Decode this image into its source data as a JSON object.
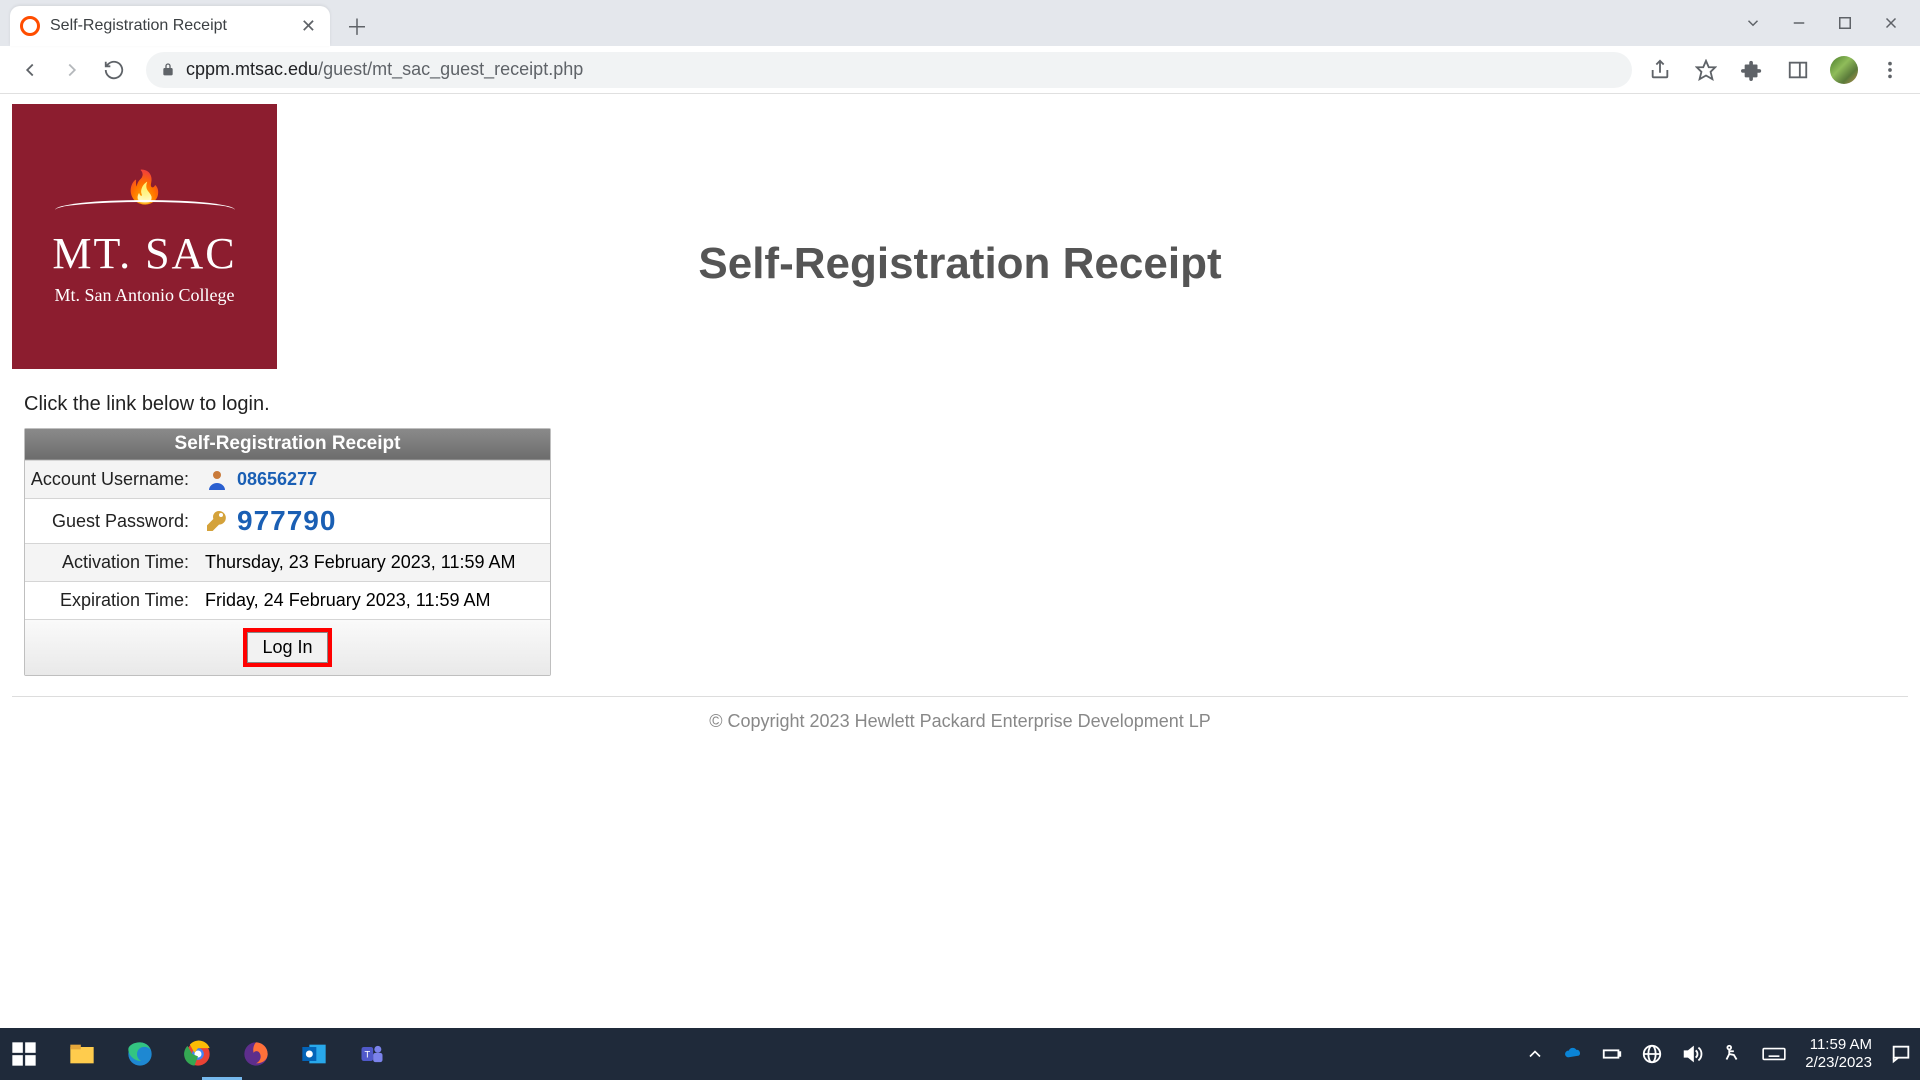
{
  "browser": {
    "tab_title": "Self-Registration Receipt",
    "url_host": "cppm.mtsac.edu",
    "url_path": "/guest/mt_sac_guest_receipt.php"
  },
  "logo": {
    "line1": "MT. SAC",
    "line2": "Mt. San Antonio College"
  },
  "page": {
    "title": "Self-Registration Receipt",
    "instruction": "Click the link below to login."
  },
  "receipt": {
    "header": "Self-Registration Receipt",
    "rows": {
      "username_label": "Account Username:",
      "username_value": "08656277",
      "password_label": "Guest Password:",
      "password_value": "977790",
      "activation_label": "Activation Time:",
      "activation_value": "Thursday, 23 February 2023, 11:59 AM",
      "expiration_label": "Expiration Time:",
      "expiration_value": "Friday, 24 February 2023, 11:59 AM"
    },
    "login_button": "Log In"
  },
  "footer": {
    "copyright": "© Copyright 2023 Hewlett Packard Enterprise Development LP"
  },
  "taskbar": {
    "time": "11:59 AM",
    "date": "2/23/2023"
  }
}
